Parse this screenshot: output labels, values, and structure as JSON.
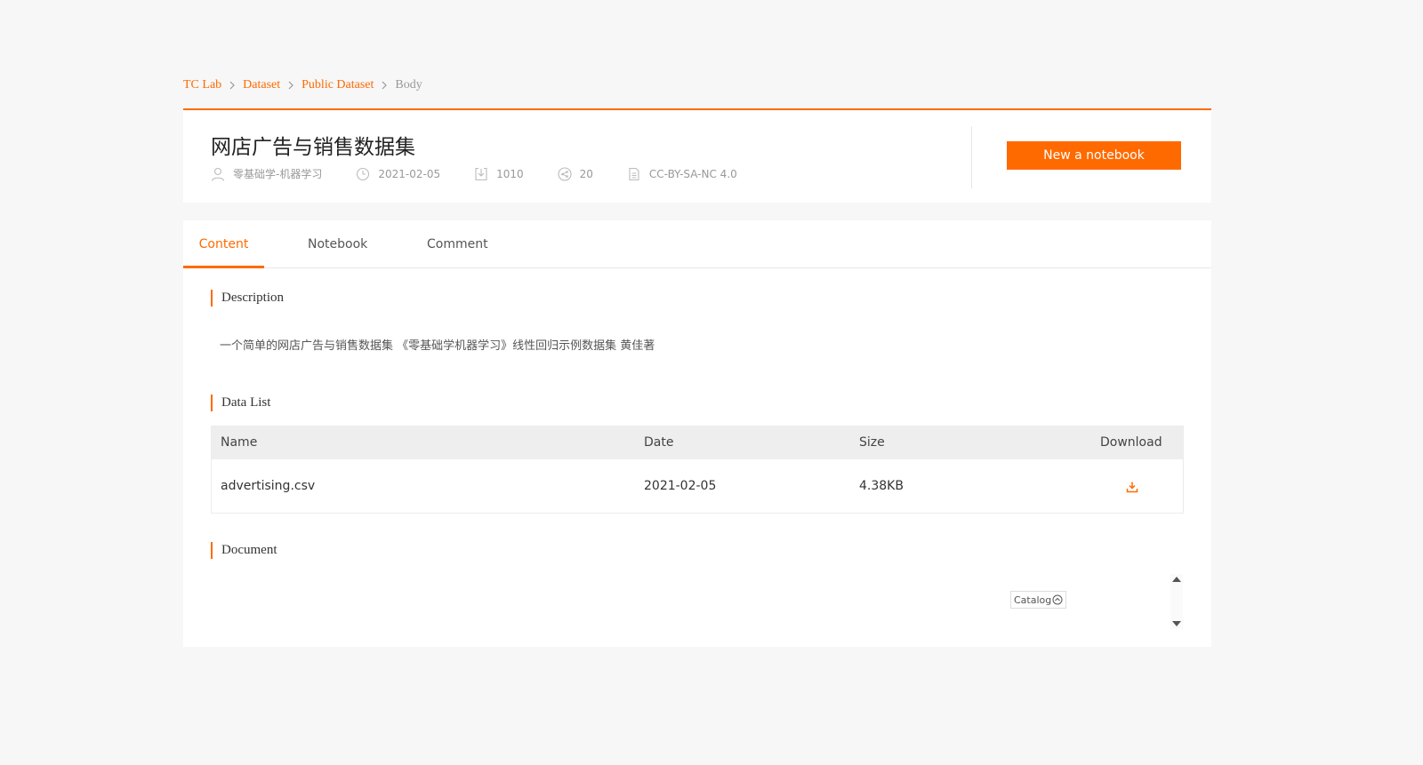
{
  "breadcrumb": {
    "items": [
      "TC Lab",
      "Dataset",
      "Public Dataset"
    ],
    "current": "Body"
  },
  "dataset": {
    "title": "网店广告与销售数据集",
    "author": "零基础学-机器学习",
    "date": "2021-02-05",
    "downloads": "1010",
    "shares": "20",
    "license": "CC-BY-SA-NC 4.0"
  },
  "actions": {
    "new_notebook": "New a notebook"
  },
  "tabs": [
    {
      "label": "Content",
      "active": true
    },
    {
      "label": "Notebook",
      "active": false
    },
    {
      "label": "Comment",
      "active": false
    }
  ],
  "sections": {
    "description_title": "Description",
    "description_text": "一个简单的网店广告与销售数据集 《零基础学机器学习》线性回归示例数据集 黄佳著",
    "data_list_title": "Data List",
    "document_title": "Document"
  },
  "table": {
    "headers": {
      "name": "Name",
      "date": "Date",
      "size": "Size",
      "download": "Download"
    },
    "rows": [
      {
        "name": "advertising.csv",
        "date": "2021-02-05",
        "size": "4.38KB"
      }
    ]
  },
  "catalog": {
    "label": "Catalog"
  },
  "colors": {
    "accent": "#ff6a00",
    "background": "#f7f7f7"
  }
}
